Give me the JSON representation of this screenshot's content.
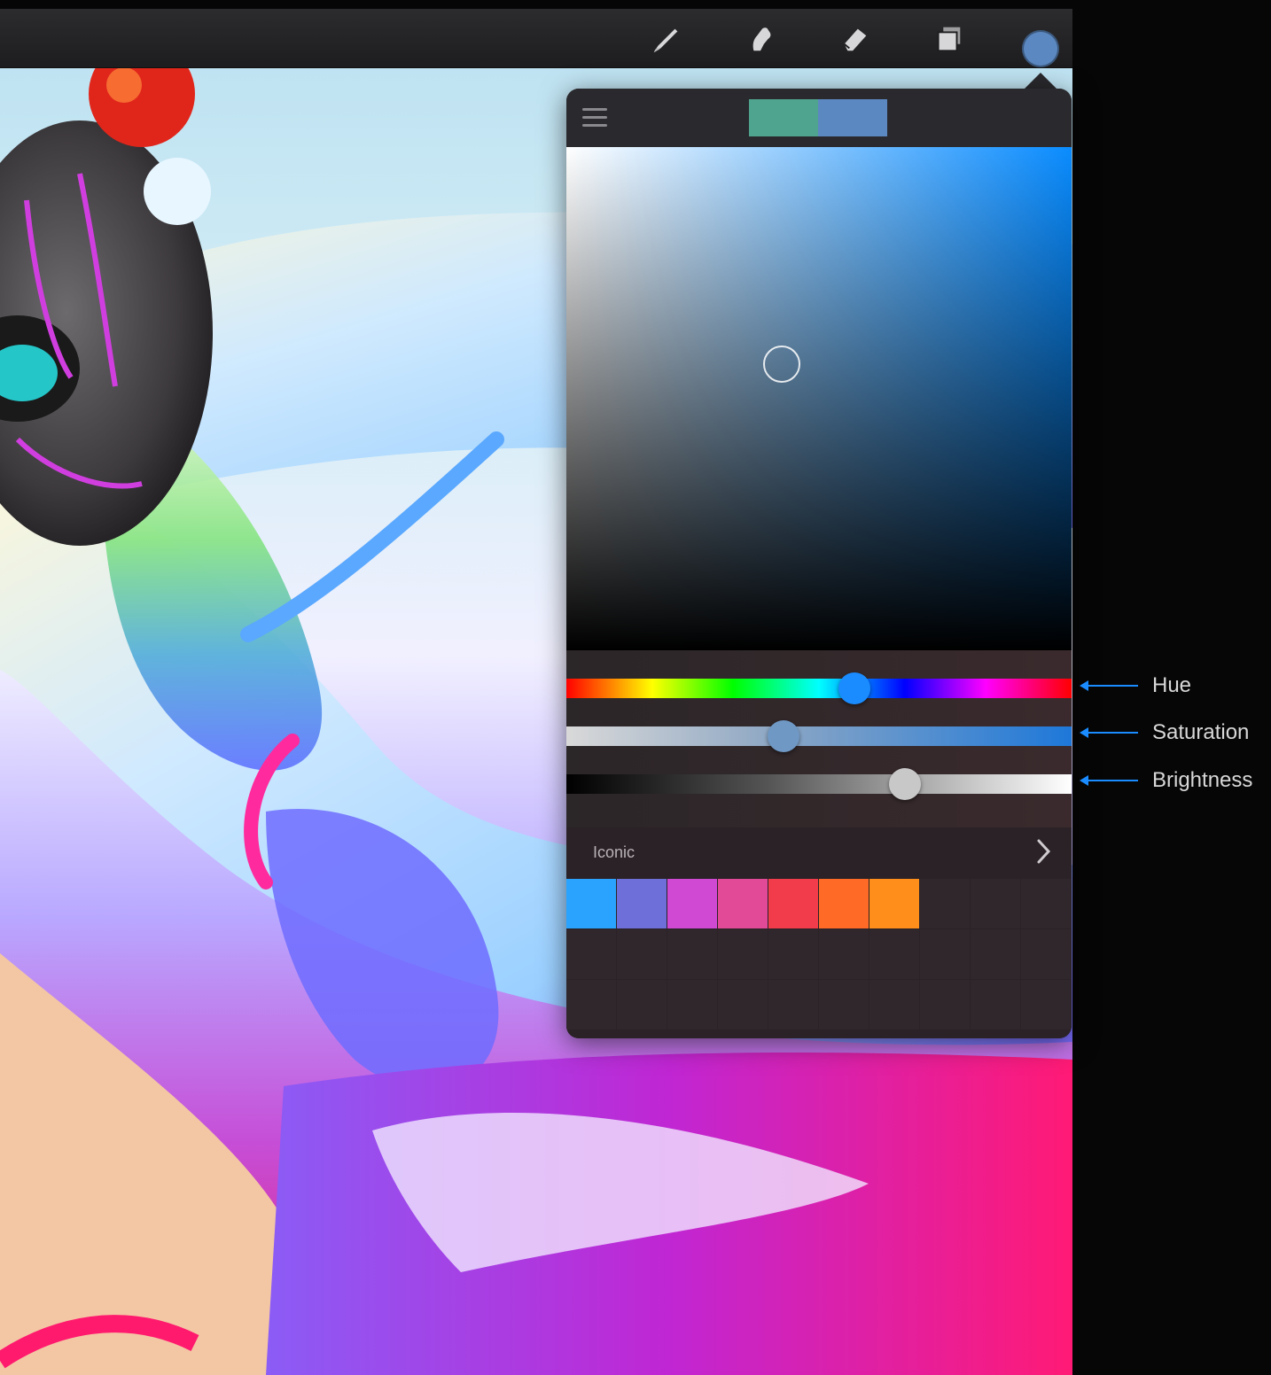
{
  "toolbar": {
    "tools": [
      {
        "name": "brush-icon"
      },
      {
        "name": "smudge-icon"
      },
      {
        "name": "eraser-icon"
      },
      {
        "name": "layers-icon"
      }
    ],
    "current_color": "#5b88c0"
  },
  "color_panel": {
    "previous_color": "#4fa48f",
    "current_color": "#5b88c0",
    "color_box_hue_color": "#0a8cff",
    "hue": {
      "value": 0.57,
      "knob_color": "#1a8cff"
    },
    "saturation": {
      "value": 0.43,
      "knob_color": "#6f98c4"
    },
    "brightness": {
      "value": 0.67,
      "knob_color": "#c8c8c8"
    },
    "palette": {
      "title": "Iconic",
      "swatches": [
        "#2aa3ff",
        "#6e6fd9",
        "#cf49d3",
        "#e24a97",
        "#f23c4b",
        "#ff6a27",
        "#ff8f1a"
      ]
    }
  },
  "annotations": [
    {
      "label": "Hue"
    },
    {
      "label": "Saturation"
    },
    {
      "label": "Brightness"
    }
  ]
}
